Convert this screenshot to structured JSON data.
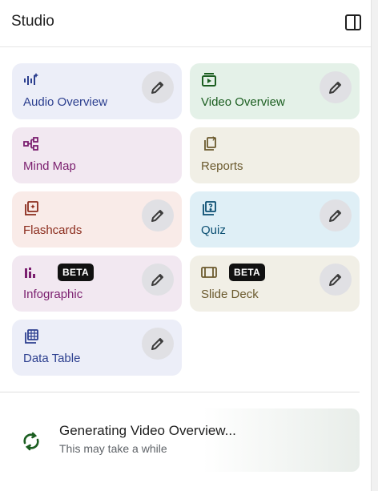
{
  "header": {
    "title": "Studio",
    "toggle_icon": "side-panel-icon"
  },
  "cards": [
    {
      "id": "audio-overview",
      "label": "Audio Overview",
      "icon": "audio-waveform-icon",
      "bg": "#eceef8",
      "color": "#2c3f8f",
      "editable": true,
      "badge": ""
    },
    {
      "id": "video-overview",
      "label": "Video Overview",
      "icon": "video-play-icon",
      "bg": "#e4f1e8",
      "color": "#1b5e20",
      "editable": true,
      "badge": ""
    },
    {
      "id": "mind-map",
      "label": "Mind Map",
      "icon": "mind-map-icon",
      "bg": "#f2e8f1",
      "color": "#7b1f6f",
      "editable": false,
      "badge": ""
    },
    {
      "id": "reports",
      "label": "Reports",
      "icon": "reports-icon",
      "bg": "#f1efe6",
      "color": "#6b5a2e",
      "editable": false,
      "badge": ""
    },
    {
      "id": "flashcards",
      "label": "Flashcards",
      "icon": "flashcards-icon",
      "bg": "#f9ebe8",
      "color": "#8b2c1d",
      "editable": true,
      "badge": ""
    },
    {
      "id": "quiz",
      "label": "Quiz",
      "icon": "quiz-icon",
      "bg": "#dfeff6",
      "color": "#0b4f72",
      "editable": true,
      "badge": ""
    },
    {
      "id": "infographic",
      "label": "Infographic",
      "icon": "infographic-icon",
      "bg": "#f2e8f1",
      "color": "#7b1f6f",
      "editable": true,
      "badge": "BETA"
    },
    {
      "id": "slide-deck",
      "label": "Slide Deck",
      "icon": "slide-deck-icon",
      "bg": "#f1efe6",
      "color": "#6b5a2e",
      "editable": true,
      "badge": "BETA"
    },
    {
      "id": "data-table",
      "label": "Data Table",
      "icon": "data-table-icon",
      "bg": "#eceef8",
      "color": "#2c3f8f",
      "editable": true,
      "badge": ""
    }
  ],
  "status": {
    "title": "Generating Video Overview...",
    "subtitle": "This may take a while",
    "icon": "sync-spinner-icon",
    "accent": "#1b5e20"
  }
}
